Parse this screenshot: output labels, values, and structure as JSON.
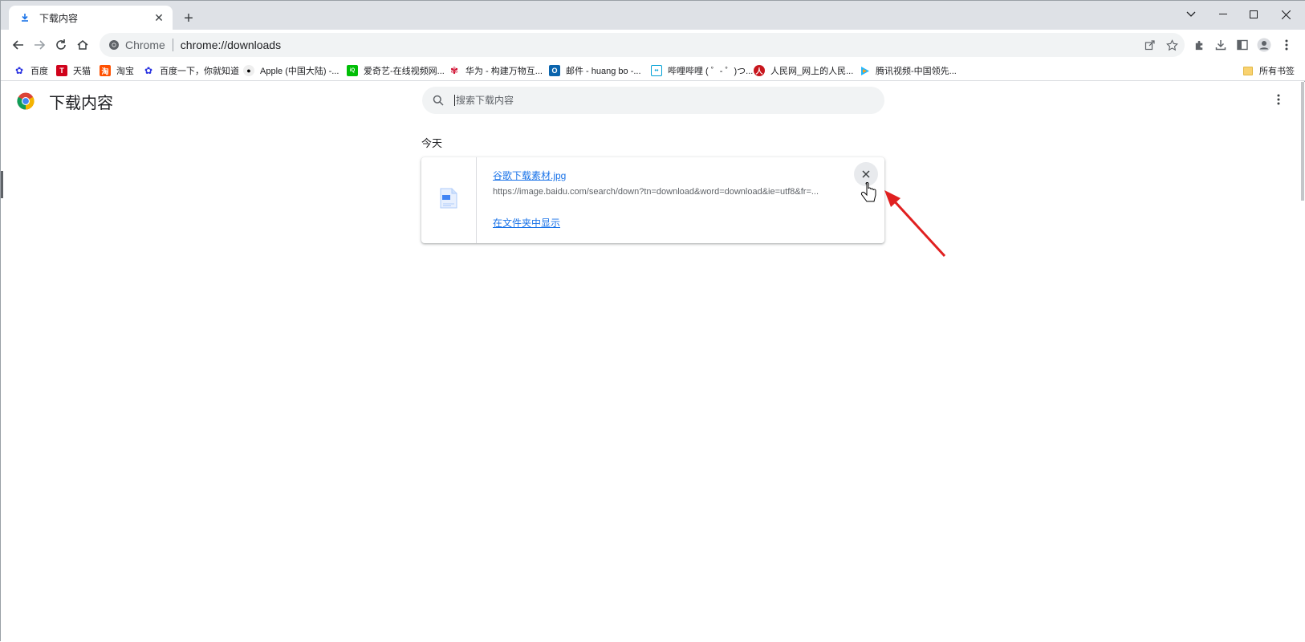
{
  "tab": {
    "title": "下载内容",
    "icon": "download-icon"
  },
  "toolbar": {
    "site_name": "Chrome",
    "url": "chrome://downloads"
  },
  "bookmarks": [
    {
      "label": "百度",
      "icon": "baidu-paw-icon",
      "color": "#2932e1"
    },
    {
      "label": "天猫",
      "icon": "tmall-icon",
      "color": "#d0021b"
    },
    {
      "label": "淘宝",
      "icon": "taobao-icon",
      "color": "#ff5000"
    },
    {
      "label": "百度一下，你就知道",
      "icon": "baidu-paw-icon",
      "color": "#2932e1"
    },
    {
      "label": "Apple (中国大陆) -...",
      "icon": "apple-icon",
      "color": "#000000"
    },
    {
      "label": "爱奇艺-在线视频网...",
      "icon": "iqiyi-icon",
      "color": "#00be06"
    },
    {
      "label": "华为 - 构建万物互...",
      "icon": "huawei-icon",
      "color": "#cf0a2c"
    },
    {
      "label": "邮件 - huang bo -...",
      "icon": "outlook-icon",
      "color": "#0a64ad"
    },
    {
      "label": "哔哩哔哩 ( ゜- ゜)つ...",
      "icon": "bilibili-icon",
      "color": "#00a1d6"
    },
    {
      "label": "人民网_网上的人民...",
      "icon": "people-daily-icon",
      "color": "#c8161d"
    },
    {
      "label": "腾讯视频-中国领先...",
      "icon": "tencent-video-icon",
      "color": "#20b7ff"
    }
  ],
  "bookmarks_folder": "所有书签",
  "page": {
    "title": "下载内容",
    "search_placeholder": "搜索下载内容",
    "date_group": "今天"
  },
  "download": {
    "file_name": "谷歌下载素材.jpg",
    "url": "https://image.baidu.com/search/down?tn=download&word=download&ie=utf8&fr=...",
    "action": "在文件夹中显示",
    "file_icon": "image-file-icon",
    "remove_icon": "close-icon"
  },
  "colors": {
    "accent": "#1a73e8",
    "annotation_arrow": "#e02020"
  }
}
